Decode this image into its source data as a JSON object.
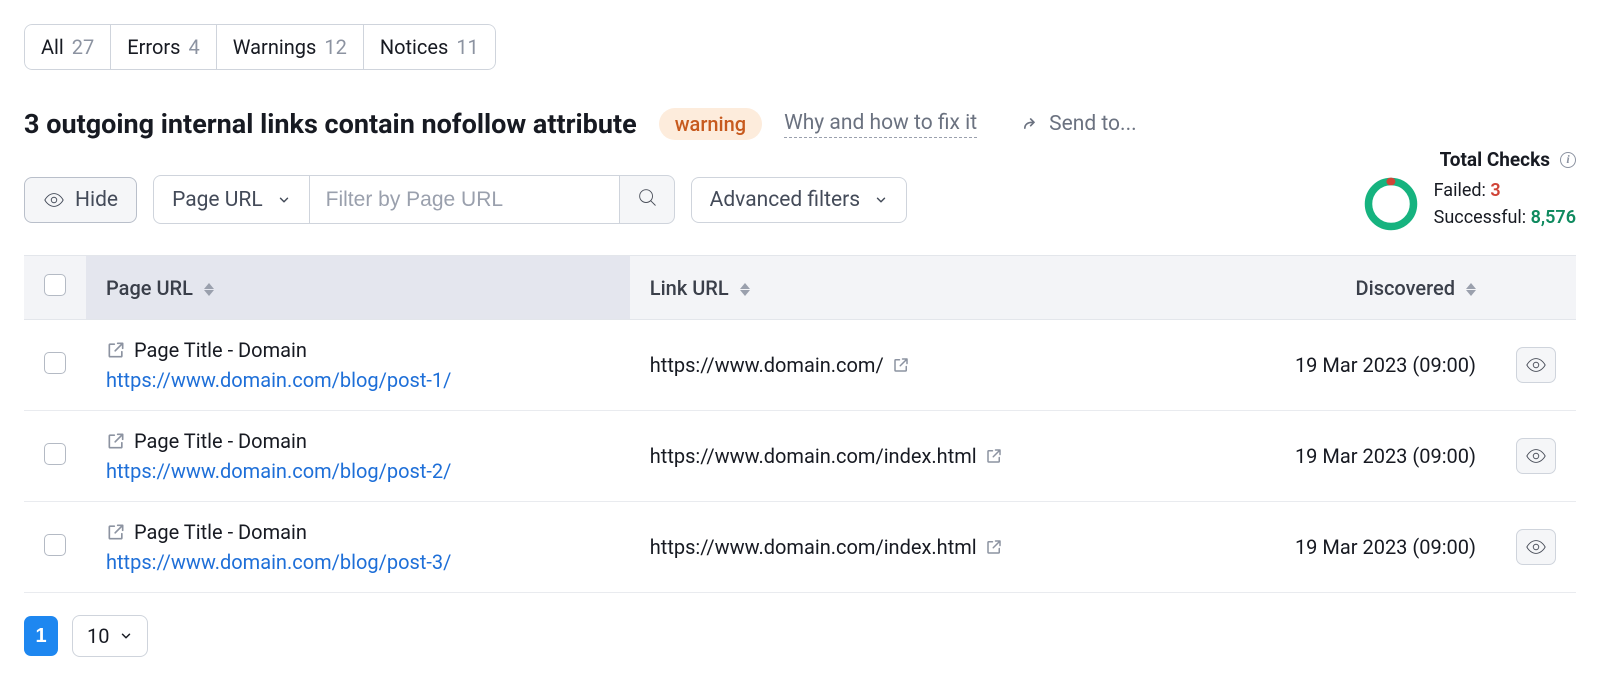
{
  "tabs": [
    {
      "label": "All",
      "count": "27"
    },
    {
      "label": "Errors",
      "count": "4"
    },
    {
      "label": "Warnings",
      "count": "12"
    },
    {
      "label": "Notices",
      "count": "11"
    }
  ],
  "heading": {
    "title": "3 outgoing internal links contain nofollow attribute",
    "badge": "warning",
    "fix_link": "Why and how to fix it",
    "send_to": "Send to..."
  },
  "toolbar": {
    "hide": "Hide",
    "filter_field": "Page URL",
    "filter_placeholder": "Filter by Page URL",
    "advanced": "Advanced filters"
  },
  "checks": {
    "title": "Total Checks",
    "failed_label": "Failed:",
    "failed_value": "3",
    "successful_label": "Successful:",
    "successful_value": "8,576"
  },
  "columns": {
    "page_url": "Page URL",
    "link_url": "Link URL",
    "discovered": "Discovered"
  },
  "rows": [
    {
      "page_title": "Page Title - Domain",
      "page_url": "https://www.domain.com/blog/post-1/",
      "link_url": "https://www.domain.com/",
      "discovered": "19 Mar 2023 (09:00)"
    },
    {
      "page_title": "Page Title - Domain",
      "page_url": "https://www.domain.com/blog/post-2/",
      "link_url": "https://www.domain.com/index.html",
      "discovered": "19 Mar 2023 (09:00)"
    },
    {
      "page_title": "Page Title - Domain",
      "page_url": "https://www.domain.com/blog/post-3/",
      "link_url": "https://www.domain.com/index.html",
      "discovered": "19 Mar 2023 (09:00)"
    }
  ],
  "pagination": {
    "current": "1",
    "page_size": "10"
  }
}
